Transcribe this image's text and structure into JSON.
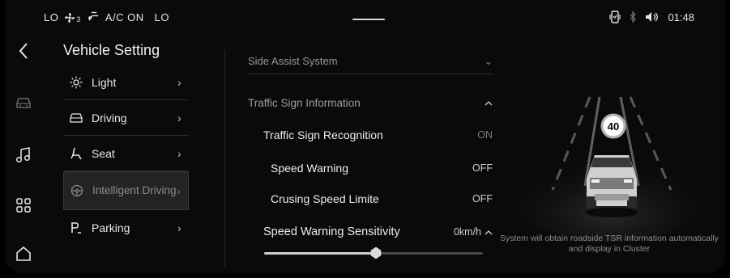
{
  "status_bar": {
    "climate_left": "LO",
    "fan_level": "3",
    "ac_label": "A/C ON",
    "climate_right": "LO",
    "time": "01:48"
  },
  "menu": {
    "title": "Vehicle Setting",
    "items": [
      {
        "label": "Light",
        "icon": "sun-icon"
      },
      {
        "label": "Driving",
        "icon": "car-icon"
      },
      {
        "label": "Seat",
        "icon": "seat-icon"
      },
      {
        "label": "Intelligent Driving",
        "icon": "steering-wheel-icon",
        "active": true
      },
      {
        "label": "Parking",
        "icon": "parking-icon"
      }
    ]
  },
  "settings": {
    "cut_row": "Side Assist System",
    "section_title": "Traffic Sign Information",
    "rows": [
      {
        "label": "Traffic Sign Recognition",
        "value": "ON"
      },
      {
        "label": "Speed Warning",
        "value": "OFF"
      },
      {
        "label": "Crusing Speed Limite",
        "value": "OFF"
      },
      {
        "label": "Speed Warning Sensitivity",
        "value": "0km/h"
      }
    ],
    "slider_fraction": 0.51
  },
  "illustration": {
    "speed_sign": "40",
    "caption": "System will obtain roadside TSR information automatically and display in Cluster"
  }
}
